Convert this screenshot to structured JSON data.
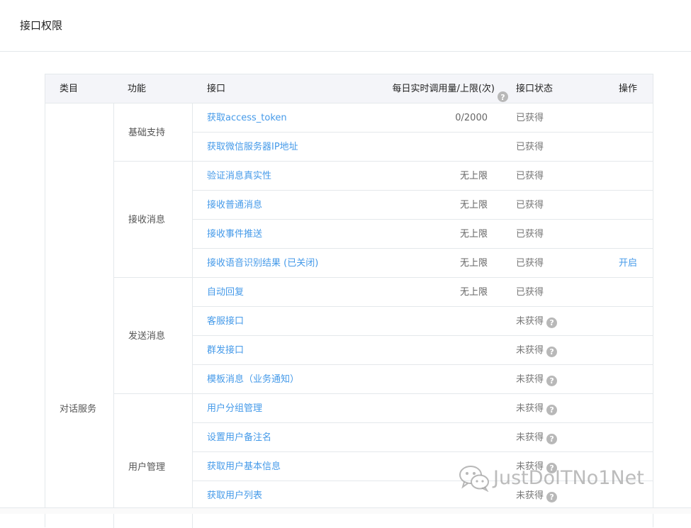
{
  "page": {
    "title": "接口权限"
  },
  "table": {
    "headers": {
      "category": "类目",
      "feature": "功能",
      "api": "接口",
      "daily_limit": "每日实时调用量/上限(次)",
      "status": "接口状态",
      "action": "操作"
    },
    "category": "对话服务",
    "groups": [
      {
        "label": "基础支持"
      },
      {
        "label": "接收消息"
      },
      {
        "label": "发送消息"
      },
      {
        "label": "用户管理"
      }
    ],
    "rows": [
      {
        "api": "获取access_token",
        "limit": "0/2000",
        "status": "已获得",
        "action": ""
      },
      {
        "api": "获取微信服务器IP地址",
        "limit": "",
        "status": "已获得",
        "action": ""
      },
      {
        "api": "验证消息真实性",
        "limit": "无上限",
        "status": "已获得",
        "action": ""
      },
      {
        "api": "接收普通消息",
        "limit": "无上限",
        "status": "已获得",
        "action": ""
      },
      {
        "api": "接收事件推送",
        "limit": "无上限",
        "status": "已获得",
        "action": ""
      },
      {
        "api": "接收语音识别结果 (已关闭)",
        "limit": "无上限",
        "status": "已获得",
        "action": "开启"
      },
      {
        "api": "自动回复",
        "limit": "无上限",
        "status": "已获得",
        "action": ""
      },
      {
        "api": "客服接口",
        "limit": "",
        "status": "未获得",
        "action": ""
      },
      {
        "api": "群发接口",
        "limit": "",
        "status": "未获得",
        "action": ""
      },
      {
        "api": "模板消息（业务通知）",
        "limit": "",
        "status": "未获得",
        "action": ""
      },
      {
        "api": "用户分组管理",
        "limit": "",
        "status": "未获得",
        "action": ""
      },
      {
        "api": "设置用户备注名",
        "limit": "",
        "status": "未获得",
        "action": ""
      },
      {
        "api": "获取用户基本信息",
        "limit": "",
        "status": "未获得",
        "action": ""
      },
      {
        "api": "获取用户列表",
        "limit": "",
        "status": "未获得",
        "action": ""
      }
    ]
  },
  "help_icon": {
    "glyph": "?",
    "icon": "question-circle-icon"
  },
  "watermark": {
    "text": "JustDoITNo1Net",
    "icon": "wechat-logo-icon"
  },
  "colors": {
    "link": "#459ae9",
    "header_bg": "#f4f5f9",
    "border": "#e4e8eb",
    "help_icon": "#b8b8b8"
  }
}
